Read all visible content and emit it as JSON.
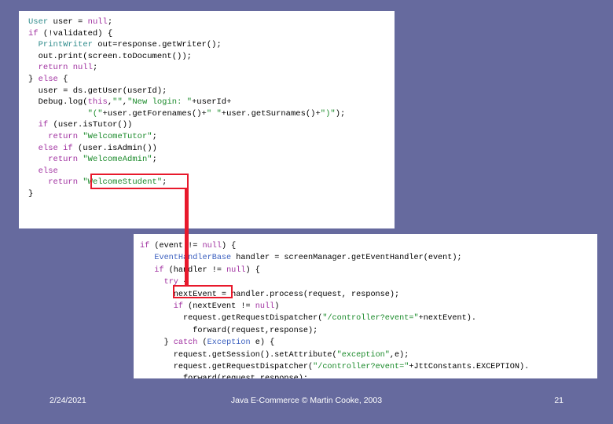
{
  "slide": {
    "background_color": "#666a9e",
    "panel_background_color": "#ffffff",
    "annotation_color": "#e8192c"
  },
  "code_panel_top": {
    "name": "login-handler-code",
    "lines": [
      [
        {
          "text": "User",
          "cls": "t-type"
        },
        {
          "text": " user = ",
          "cls": "t-plain"
        },
        {
          "text": "null",
          "cls": "t-kw"
        },
        {
          "text": ";",
          "cls": "t-plain"
        }
      ],
      [
        {
          "text": "if",
          "cls": "t-kw"
        },
        {
          "text": " (!validated) {",
          "cls": "t-plain"
        }
      ],
      [
        {
          "text": "  ",
          "cls": "t-plain"
        },
        {
          "text": "PrintWriter",
          "cls": "t-type"
        },
        {
          "text": " out=response.getWriter();",
          "cls": "t-plain"
        }
      ],
      [
        {
          "text": "  out.print(screen.toDocument());",
          "cls": "t-plain"
        }
      ],
      [
        {
          "text": "  ",
          "cls": "t-plain"
        },
        {
          "text": "return",
          "cls": "t-kw"
        },
        {
          "text": " ",
          "cls": "t-plain"
        },
        {
          "text": "null",
          "cls": "t-kw"
        },
        {
          "text": ";",
          "cls": "t-plain"
        }
      ],
      [
        {
          "text": "} ",
          "cls": "t-plain"
        },
        {
          "text": "else",
          "cls": "t-kw"
        },
        {
          "text": " {",
          "cls": "t-plain"
        }
      ],
      [
        {
          "text": "  user = ds.getUser(userId);",
          "cls": "t-plain"
        }
      ],
      [
        {
          "text": "  Debug.log(",
          "cls": "t-plain"
        },
        {
          "text": "this",
          "cls": "t-kw"
        },
        {
          "text": ",",
          "cls": "t-plain"
        },
        {
          "text": "\"\"",
          "cls": "t-str"
        },
        {
          "text": ",",
          "cls": "t-plain"
        },
        {
          "text": "\"New login: \"",
          "cls": "t-str"
        },
        {
          "text": "+userId+",
          "cls": "t-plain"
        }
      ],
      [
        {
          "text": "            ",
          "cls": "t-plain"
        },
        {
          "text": "\"(\"",
          "cls": "t-str"
        },
        {
          "text": "+user.getForenames()+",
          "cls": "t-plain"
        },
        {
          "text": "\" \"",
          "cls": "t-str"
        },
        {
          "text": "+user.getSurnames()+",
          "cls": "t-plain"
        },
        {
          "text": "\")\"",
          "cls": "t-str"
        },
        {
          "text": ");",
          "cls": "t-plain"
        }
      ],
      [
        {
          "text": "  ",
          "cls": "t-plain"
        },
        {
          "text": "if",
          "cls": "t-kw"
        },
        {
          "text": " (user.isTutor())",
          "cls": "t-plain"
        }
      ],
      [
        {
          "text": "    ",
          "cls": "t-plain"
        },
        {
          "text": "return",
          "cls": "t-kw"
        },
        {
          "text": " ",
          "cls": "t-plain"
        },
        {
          "text": "\"WelcomeTutor\"",
          "cls": "t-str"
        },
        {
          "text": ";",
          "cls": "t-plain"
        }
      ],
      [
        {
          "text": "  ",
          "cls": "t-plain"
        },
        {
          "text": "else if",
          "cls": "t-kw"
        },
        {
          "text": " (user.isAdmin())",
          "cls": "t-plain"
        }
      ],
      [
        {
          "text": "    ",
          "cls": "t-plain"
        },
        {
          "text": "return",
          "cls": "t-kw"
        },
        {
          "text": " ",
          "cls": "t-plain"
        },
        {
          "text": "\"WelcomeAdmin\"",
          "cls": "t-str"
        },
        {
          "text": ";",
          "cls": "t-plain"
        }
      ],
      [
        {
          "text": "  ",
          "cls": "t-plain"
        },
        {
          "text": "else",
          "cls": "t-kw"
        }
      ],
      [
        {
          "text": "    ",
          "cls": "t-plain"
        },
        {
          "text": "return",
          "cls": "t-kw"
        },
        {
          "text": " ",
          "cls": "t-plain"
        },
        {
          "text": "\"WelcomeStudent\"",
          "cls": "t-str"
        },
        {
          "text": ";",
          "cls": "t-plain"
        }
      ],
      [
        {
          "text": "}",
          "cls": "t-plain"
        }
      ]
    ]
  },
  "code_panel_bottom": {
    "name": "controller-dispatch-code",
    "lines": [
      [
        {
          "text": "if",
          "cls": "t-kw"
        },
        {
          "text": " (event != ",
          "cls": "t-plain"
        },
        {
          "text": "null",
          "cls": "t-kw"
        },
        {
          "text": ") {",
          "cls": "t-plain"
        }
      ],
      [
        {
          "text": "   ",
          "cls": "t-plain"
        },
        {
          "text": "EventHandlerBase",
          "cls": "t-cls"
        },
        {
          "text": " handler = screenManager.getEventHandler(event);",
          "cls": "t-plain"
        }
      ],
      [
        {
          "text": "   ",
          "cls": "t-plain"
        },
        {
          "text": "if",
          "cls": "t-kw"
        },
        {
          "text": " (handler != ",
          "cls": "t-plain"
        },
        {
          "text": "null",
          "cls": "t-kw"
        },
        {
          "text": ") {",
          "cls": "t-plain"
        }
      ],
      [
        {
          "text": "     ",
          "cls": "t-plain"
        },
        {
          "text": "try",
          "cls": "t-kw"
        },
        {
          "text": " {",
          "cls": "t-plain"
        }
      ],
      [
        {
          "text": "       nextEvent = handler.process(request, response);",
          "cls": "t-plain"
        }
      ],
      [
        {
          "text": "       ",
          "cls": "t-plain"
        },
        {
          "text": "if",
          "cls": "t-kw"
        },
        {
          "text": " (nextEvent != ",
          "cls": "t-plain"
        },
        {
          "text": "null",
          "cls": "t-kw"
        },
        {
          "text": ")",
          "cls": "t-plain"
        }
      ],
      [
        {
          "text": "         request.getRequestDispatcher(",
          "cls": "t-plain"
        },
        {
          "text": "\"/controller?event=\"",
          "cls": "t-str"
        },
        {
          "text": "+nextEvent).",
          "cls": "t-plain"
        }
      ],
      [
        {
          "text": "           forward(request,response);",
          "cls": "t-plain"
        }
      ],
      [
        {
          "text": "     } ",
          "cls": "t-plain"
        },
        {
          "text": "catch",
          "cls": "t-kw"
        },
        {
          "text": " (",
          "cls": "t-plain"
        },
        {
          "text": "Exception",
          "cls": "t-cls"
        },
        {
          "text": " e) {",
          "cls": "t-plain"
        }
      ],
      [
        {
          "text": "       request.getSession().setAttribute(",
          "cls": "t-plain"
        },
        {
          "text": "\"exception\"",
          "cls": "t-str"
        },
        {
          "text": ",e);",
          "cls": "t-plain"
        }
      ],
      [
        {
          "text": "       request.getRequestDispatcher(",
          "cls": "t-plain"
        },
        {
          "text": "\"/controller?event=\"",
          "cls": "t-str"
        },
        {
          "text": "+JttConstants.EXCEPTION).",
          "cls": "t-plain"
        }
      ],
      [
        {
          "text": "         forward(request,response);",
          "cls": "t-plain"
        }
      ]
    ]
  },
  "annotations": {
    "highlight_1_label": "WelcomeStudent",
    "highlight_2_label": "nextEvent",
    "connector": "arrow-down"
  },
  "footer": {
    "date": "2/24/2021",
    "title": "Java E-Commerce © Martin Cooke, 2003",
    "page": "21"
  }
}
